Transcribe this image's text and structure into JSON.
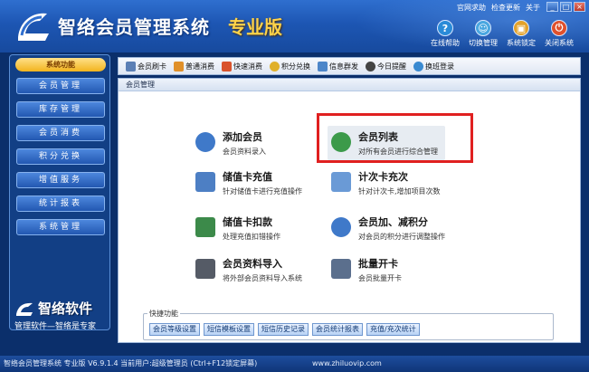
{
  "header": {
    "title": "智络会员管理系统",
    "edition": "专业版",
    "top_links": [
      "官网求助",
      "检查更新",
      "关于"
    ],
    "window_buttons": [
      "_",
      "□",
      "×"
    ],
    "buttons": [
      {
        "label": "在线帮助",
        "icon": "help-icon",
        "color": "#2a8bd8"
      },
      {
        "label": "切换管理",
        "icon": "people-icon",
        "color": "#4aa7e0"
      },
      {
        "label": "系统锁定",
        "icon": "lock-icon",
        "color": "#e3a22a"
      },
      {
        "label": "关闭系统",
        "icon": "power-icon",
        "color": "#e0502c"
      }
    ]
  },
  "sidebar": {
    "heading": "系统功能",
    "items": [
      "会员管理",
      "库存管理",
      "会员消费",
      "积分兑换",
      "增值服务",
      "统计报表",
      "系统管理"
    ]
  },
  "brand": {
    "name": "智络软件",
    "slogan": "管理软件—智络是专家"
  },
  "toolbar": {
    "items": [
      {
        "label": "会员刷卡",
        "icon": "card-icon",
        "color": "#5b7fb5"
      },
      {
        "label": "普通消费",
        "icon": "cart-icon",
        "color": "#e0902a"
      },
      {
        "label": "快速消费",
        "icon": "fast-icon",
        "color": "#d9532c"
      },
      {
        "label": "积分兑换",
        "icon": "exchange-icon",
        "color": "#e0b02a"
      },
      {
        "label": "信息群发",
        "icon": "message-icon",
        "color": "#4d86c9"
      },
      {
        "label": "今日提醒",
        "icon": "clock-icon",
        "color": "#444444"
      },
      {
        "label": "换班登录",
        "icon": "switch-icon",
        "color": "#3a8ad1"
      }
    ]
  },
  "panel": {
    "title": "会员管理",
    "functions": [
      {
        "title": "添加会员",
        "desc": "会员资料录入",
        "icon": "add-member-icon",
        "color": "#3f79c9"
      },
      {
        "title": "会员列表",
        "desc": "对所有会员进行综合管理",
        "icon": "member-list-icon",
        "color": "#3c9a4a"
      },
      {
        "title": "储值卡充值",
        "desc": "针对储值卡进行充值操作",
        "icon": "recharge-icon",
        "color": "#4d7fc4"
      },
      {
        "title": "计次卡充次",
        "desc": "针对计次卡,增加项目次数",
        "icon": "count-card-icon",
        "color": "#6a9ad6"
      },
      {
        "title": "储值卡扣款",
        "desc": "处理充值扣错操作",
        "icon": "deduct-icon",
        "color": "#3c8a4a"
      },
      {
        "title": "会员加、减积分",
        "desc": "对会员的积分进行调整操作",
        "icon": "points-icon",
        "color": "#3f79c9"
      },
      {
        "title": "会员资料导入",
        "desc": "将外部会员资料导入系统",
        "icon": "import-icon",
        "color": "#555b66"
      },
      {
        "title": "批量开卡",
        "desc": "会员批量开卡",
        "icon": "batch-card-icon",
        "color": "#5b6f8d"
      }
    ]
  },
  "quick": {
    "label": "快捷功能",
    "buttons": [
      "会员等级设置",
      "短信模板设置",
      "短信历史记录",
      "会员统计报表",
      "充值/充次统计"
    ]
  },
  "status": {
    "text": "智络会员管理系统 专业版 V6.9.1.4 当前用户:超级管理员 (Ctrl+F12锁定屏幕)",
    "url": "www.zhiluovip.com"
  }
}
